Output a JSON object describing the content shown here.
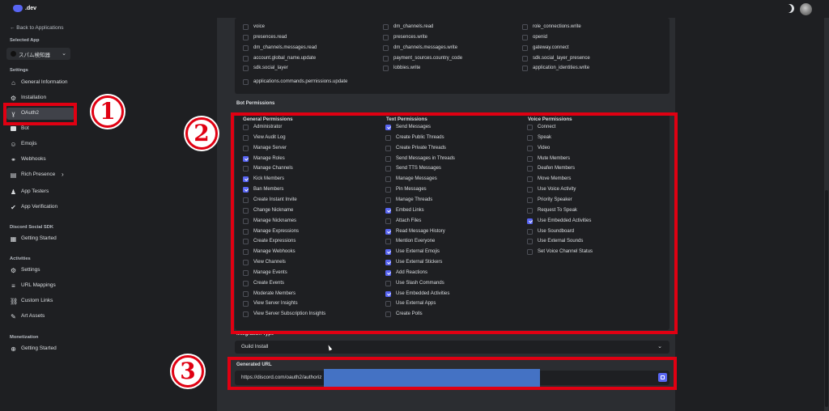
{
  "header": {
    "logo_text": ".dev",
    "theme_icon": "moon-icon",
    "avatar_icon": "user-avatar"
  },
  "sidebar": {
    "back_label": "← Back to Applications",
    "selected_app_heading": "Selected App",
    "app_name": "スパム検知器",
    "settings_heading": "Settings",
    "items": [
      {
        "label": "General Information",
        "icon": "home-icon"
      },
      {
        "label": "Installation",
        "icon": "gear-icon"
      },
      {
        "label": "OAuth2",
        "icon": "wrench-icon"
      },
      {
        "label": "Bot",
        "icon": "robot-icon"
      },
      {
        "label": "Emojis",
        "icon": "smile-icon"
      },
      {
        "label": "Webhooks",
        "icon": "webhook-icon"
      },
      {
        "label": "Rich Presence",
        "icon": "document-icon"
      },
      {
        "label": "App Testers",
        "icon": "person-icon"
      },
      {
        "label": "App Verification",
        "icon": "verified-icon"
      }
    ],
    "social_sdk_heading": "Discord Social SDK",
    "social_items": [
      {
        "label": "Getting Started",
        "icon": "grid-icon"
      }
    ],
    "activities_heading": "Activities",
    "activity_items": [
      {
        "label": "Settings",
        "icon": "gear-icon"
      },
      {
        "label": "URL Mappings",
        "icon": "list-icon"
      },
      {
        "label": "Custom Links",
        "icon": "link-icon"
      },
      {
        "label": "Art Assets",
        "icon": "image-icon"
      }
    ],
    "monetization_heading": "Monetization",
    "monetization_items": [
      {
        "label": "Getting Started",
        "icon": "plus-circle-icon"
      }
    ]
  },
  "scopes": {
    "rows": [
      [
        "voice",
        "dm_channels.read",
        "role_connections.write"
      ],
      [
        "presences.read",
        "presences.write",
        "openid"
      ],
      [
        "dm_channels.messages.read",
        "dm_channels.messages.write",
        "gateway.connect"
      ],
      [
        "account.global_name.update",
        "payment_sources.country_code",
        "sdk.social_layer_presence"
      ],
      [
        "sdk.social_layer",
        "lobbies.write",
        "application_identities.write"
      ],
      [
        "applications.commands.permissions.update",
        "",
        ""
      ]
    ]
  },
  "bot_permissions": {
    "title": "Bot Permissions",
    "columns": [
      {
        "heading": "General Permissions",
        "items": [
          {
            "label": "Administrator",
            "checked": false
          },
          {
            "label": "View Audit Log",
            "checked": false
          },
          {
            "label": "Manage Server",
            "checked": false
          },
          {
            "label": "Manage Roles",
            "checked": true
          },
          {
            "label": "Manage Channels",
            "checked": false
          },
          {
            "label": "Kick Members",
            "checked": true
          },
          {
            "label": "Ban Members",
            "checked": true
          },
          {
            "label": "Create Instant Invite",
            "checked": false
          },
          {
            "label": "Change Nickname",
            "checked": false
          },
          {
            "label": "Manage Nicknames",
            "checked": false
          },
          {
            "label": "Manage Expressions",
            "checked": false
          },
          {
            "label": "Create Expressions",
            "checked": false
          },
          {
            "label": "Manage Webhooks",
            "checked": false
          },
          {
            "label": "View Channels",
            "checked": false
          },
          {
            "label": "Manage Events",
            "checked": false
          },
          {
            "label": "Create Events",
            "checked": false
          },
          {
            "label": "Moderate Members",
            "checked": false
          },
          {
            "label": "View Server Insights",
            "checked": false
          },
          {
            "label": "View Server Subscription Insights",
            "checked": false
          }
        ]
      },
      {
        "heading": "Text Permissions",
        "items": [
          {
            "label": "Send Messages",
            "checked": true
          },
          {
            "label": "Create Public Threads",
            "checked": false
          },
          {
            "label": "Create Private Threads",
            "checked": false
          },
          {
            "label": "Send Messages in Threads",
            "checked": false
          },
          {
            "label": "Send TTS Messages",
            "checked": false
          },
          {
            "label": "Manage Messages",
            "checked": false
          },
          {
            "label": "Pin Messages",
            "checked": false
          },
          {
            "label": "Manage Threads",
            "checked": false
          },
          {
            "label": "Embed Links",
            "checked": true
          },
          {
            "label": "Attach Files",
            "checked": false
          },
          {
            "label": "Read Message History",
            "checked": true
          },
          {
            "label": "Mention Everyone",
            "checked": false
          },
          {
            "label": "Use External Emojis",
            "checked": true
          },
          {
            "label": "Use External Stickers",
            "checked": true
          },
          {
            "label": "Add Reactions",
            "checked": true
          },
          {
            "label": "Use Slash Commands",
            "checked": false
          },
          {
            "label": "Use Embedded Activities",
            "checked": true
          },
          {
            "label": "Use External Apps",
            "checked": false
          },
          {
            "label": "Create Polls",
            "checked": false
          }
        ]
      },
      {
        "heading": "Voice Permissions",
        "items": [
          {
            "label": "Connect",
            "checked": false
          },
          {
            "label": "Speak",
            "checked": false
          },
          {
            "label": "Video",
            "checked": false
          },
          {
            "label": "Mute Members",
            "checked": false
          },
          {
            "label": "Deafen Members",
            "checked": false
          },
          {
            "label": "Move Members",
            "checked": false
          },
          {
            "label": "Use Voice Activity",
            "checked": false
          },
          {
            "label": "Priority Speaker",
            "checked": false
          },
          {
            "label": "Request To Speak",
            "checked": false
          },
          {
            "label": "Use Embedded Activities",
            "checked": true
          },
          {
            "label": "Use Soundboard",
            "checked": false
          },
          {
            "label": "Use External Sounds",
            "checked": false
          },
          {
            "label": "Set Voice Channel Status",
            "checked": false
          }
        ]
      }
    ]
  },
  "integration": {
    "title": "Integration Type",
    "value": "Guild Install"
  },
  "generated_url": {
    "title": "Generated URL",
    "value": "https://discord.com/oauth2/authoriz"
  },
  "annotations": {
    "badge1": "1",
    "badge2": "2",
    "badge3": "3",
    "color": "#e00012"
  }
}
